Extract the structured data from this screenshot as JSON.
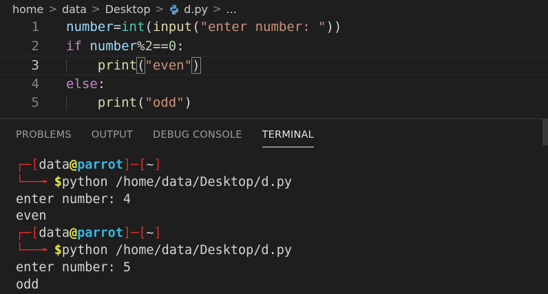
{
  "breadcrumb": {
    "items": [
      "home",
      "data",
      "Desktop",
      "d.py",
      "..."
    ],
    "separator": ">",
    "file_icon": "python-icon"
  },
  "editor": {
    "lines": [
      {
        "num": "1",
        "tokens": [
          {
            "t": "number",
            "c": "var"
          },
          {
            "t": "=",
            "c": "pn"
          },
          {
            "t": "int",
            "c": "bi"
          },
          {
            "t": "(",
            "c": "pn"
          },
          {
            "t": "input",
            "c": "fn"
          },
          {
            "t": "(",
            "c": "pn"
          },
          {
            "t": "\"enter number: \"",
            "c": "str"
          },
          {
            "t": "))",
            "c": "pn"
          }
        ]
      },
      {
        "num": "2",
        "tokens": [
          {
            "t": "if",
            "c": "kw"
          },
          {
            "t": " ",
            "c": "pn"
          },
          {
            "t": "number",
            "c": "var"
          },
          {
            "t": "%",
            "c": "pn"
          },
          {
            "t": "2",
            "c": "num"
          },
          {
            "t": "==",
            "c": "pn"
          },
          {
            "t": "0",
            "c": "num"
          },
          {
            "t": ":",
            "c": "pn"
          }
        ]
      },
      {
        "num": "3",
        "tokens": [
          {
            "t": "    ",
            "c": "pn"
          },
          {
            "t": "print",
            "c": "pr"
          },
          {
            "t": "(",
            "c": "pn brace-hl"
          },
          {
            "t": "\"even\"",
            "c": "str"
          },
          {
            "t": ")",
            "c": "pn brace-hl"
          }
        ]
      },
      {
        "num": "4",
        "tokens": [
          {
            "t": "else",
            "c": "kw"
          },
          {
            "t": ":",
            "c": "pn"
          }
        ]
      },
      {
        "num": "5",
        "tokens": [
          {
            "t": "    ",
            "c": "pn"
          },
          {
            "t": "print",
            "c": "pr"
          },
          {
            "t": "(",
            "c": "pn"
          },
          {
            "t": "\"odd\"",
            "c": "str"
          },
          {
            "t": ")",
            "c": "pn"
          }
        ]
      }
    ],
    "active_line": 3
  },
  "panel": {
    "tabs": [
      "PROBLEMS",
      "OUTPUT",
      "DEBUG CONSOLE",
      "TERMINAL"
    ],
    "active_tab": "TERMINAL"
  },
  "terminal": {
    "prompt": {
      "open": "┌─[",
      "user": "data",
      "at": "@",
      "host": "parrot",
      "mid": "]─[",
      "dir": "~",
      "close": "]",
      "corner": "└──╼ ",
      "dollar": "$"
    },
    "sessions": [
      {
        "command": "python /home/data/Desktop/d.py",
        "output": [
          "enter number: 4",
          "even"
        ]
      },
      {
        "command": "python /home/data/Desktop/d.py",
        "output": [
          "enter number: 5",
          "odd"
        ]
      }
    ]
  },
  "colors": {
    "background": "#1e1e1e",
    "prompt_red": "#e02a2a",
    "host_cyan": "#3ab5e0",
    "at_yellow": "#e8e84a"
  }
}
